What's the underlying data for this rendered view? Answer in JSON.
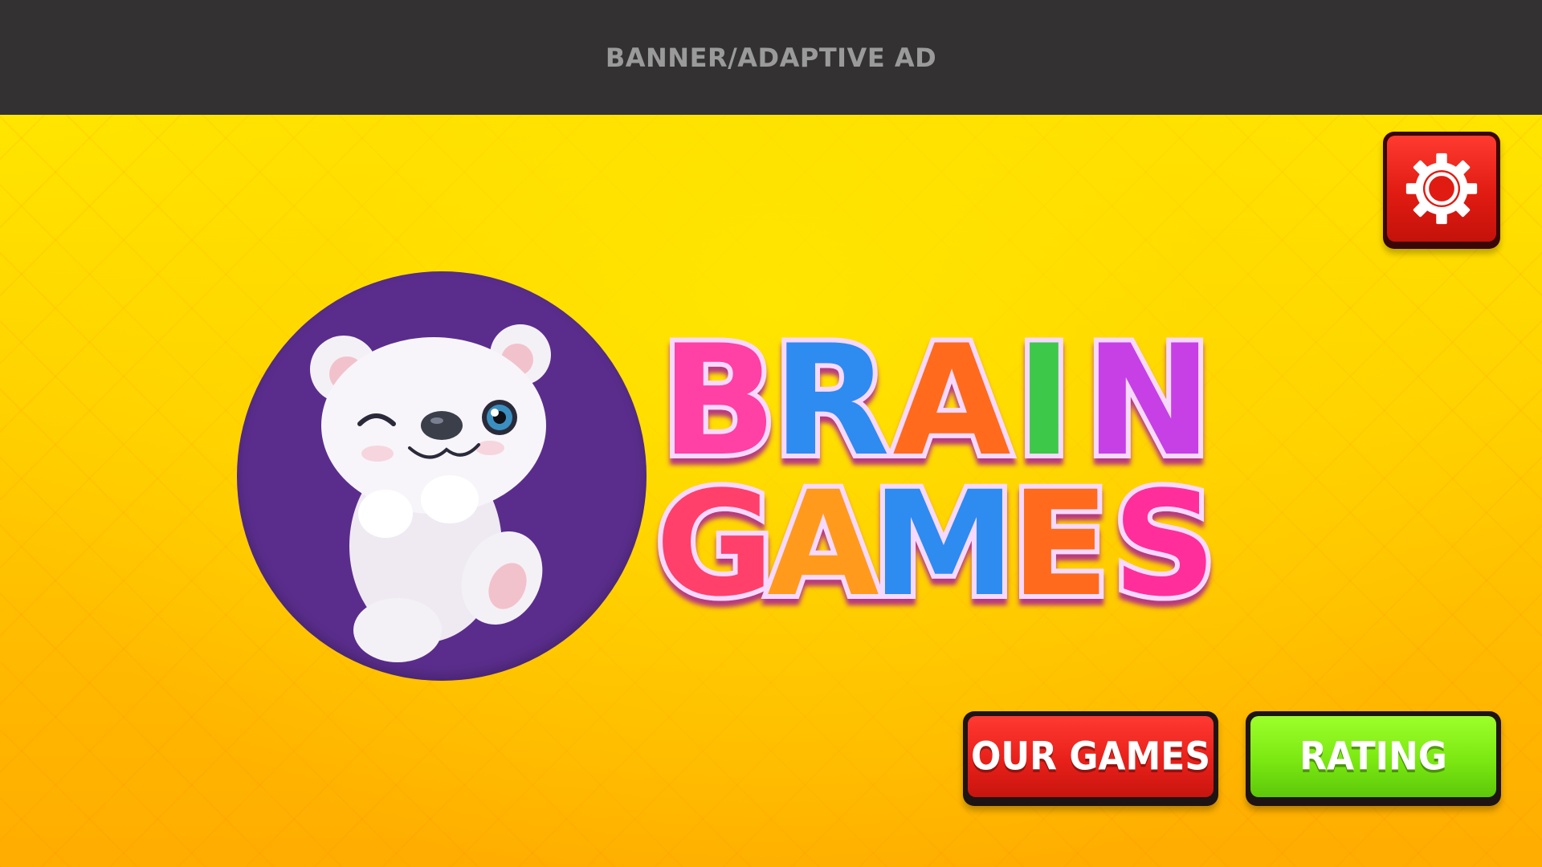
{
  "ad_banner": {
    "text": "BANNER/ADAPTIVE AD"
  },
  "settings_button": {
    "icon": "gear-icon"
  },
  "logo": {
    "icon": "polar-bear-mascot",
    "circle_color": "#5a2d8c"
  },
  "title": {
    "line1": [
      "B",
      "R",
      "A",
      "I",
      "N"
    ],
    "line2": [
      "G",
      "A",
      "M",
      "E",
      "S"
    ],
    "line1_colors": [
      "#ff3fa4",
      "#2f8bf0",
      "#ff6a1a",
      "#3cc84a",
      "#c63fe6"
    ],
    "line2_colors": [
      "#ff3f6a",
      "#ff9a1a",
      "#b040e0",
      "#2f8bf0",
      "#ff6a1a",
      "#ff2f9a"
    ]
  },
  "buttons": {
    "our_games": "OUR GAMES",
    "rating": "RATING"
  },
  "colors": {
    "background_top": "#ffe600",
    "background_bottom": "#ffad00",
    "banner": "#333131",
    "red_button": "#e8201a",
    "green_button": "#7be812"
  }
}
